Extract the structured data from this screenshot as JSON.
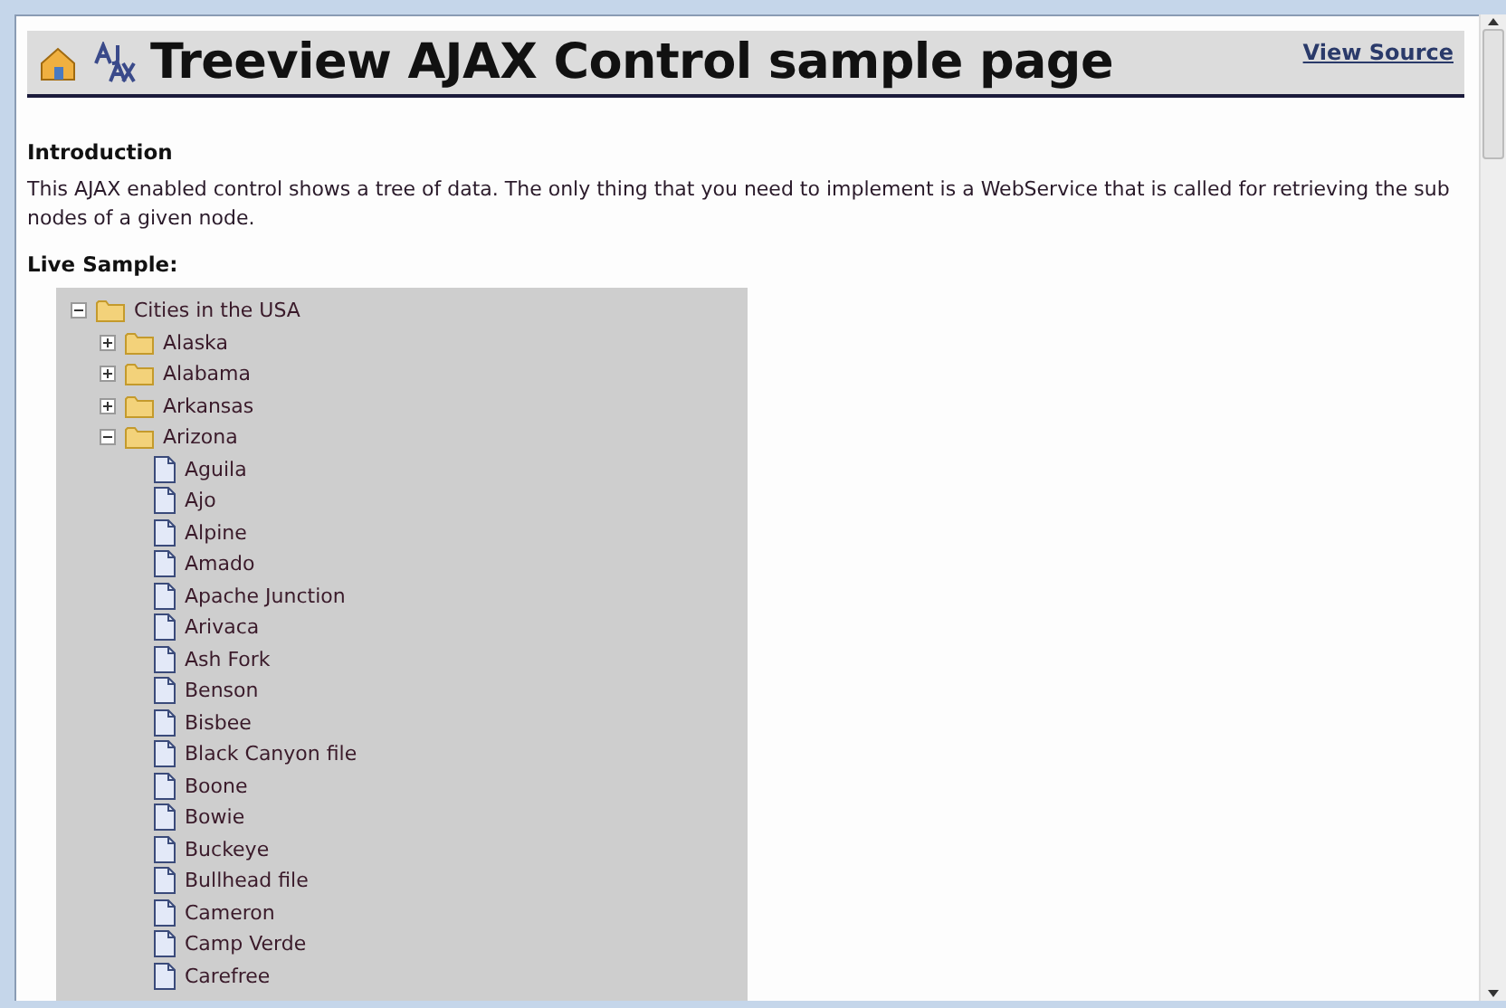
{
  "header": {
    "title": "Treeview AJAX Control sample page",
    "link": "View Source"
  },
  "intro": {
    "heading": "Introduction",
    "text": "This AJAX enabled control shows a tree of data. The only thing that you need to implement is a WebService that is called for retrieving the sub nodes of a given node."
  },
  "sample_heading": "Live Sample:",
  "tree": [
    {
      "label": "Cities in the USA",
      "kind": "folder",
      "expanded": true,
      "children": [
        {
          "label": "Alaska",
          "kind": "folder",
          "expanded": false
        },
        {
          "label": "Alabama",
          "kind": "folder",
          "expanded": false
        },
        {
          "label": "Arkansas",
          "kind": "folder",
          "expanded": false
        },
        {
          "label": "Arizona",
          "kind": "folder",
          "expanded": true,
          "children": [
            {
              "label": "Aguila",
              "kind": "file"
            },
            {
              "label": "Ajo",
              "kind": "file"
            },
            {
              "label": "Alpine",
              "kind": "file"
            },
            {
              "label": "Amado",
              "kind": "file"
            },
            {
              "label": "Apache Junction",
              "kind": "file"
            },
            {
              "label": "Arivaca",
              "kind": "file"
            },
            {
              "label": "Ash Fork",
              "kind": "file"
            },
            {
              "label": "Benson",
              "kind": "file"
            },
            {
              "label": "Bisbee",
              "kind": "file"
            },
            {
              "label": "Black Canyon file",
              "kind": "file"
            },
            {
              "label": "Boone",
              "kind": "file"
            },
            {
              "label": "Bowie",
              "kind": "file"
            },
            {
              "label": "Buckeye",
              "kind": "file"
            },
            {
              "label": "Bullhead file",
              "kind": "file"
            },
            {
              "label": "Cameron",
              "kind": "file"
            },
            {
              "label": "Camp Verde",
              "kind": "file"
            },
            {
              "label": "Carefree",
              "kind": "file"
            }
          ]
        }
      ]
    }
  ]
}
